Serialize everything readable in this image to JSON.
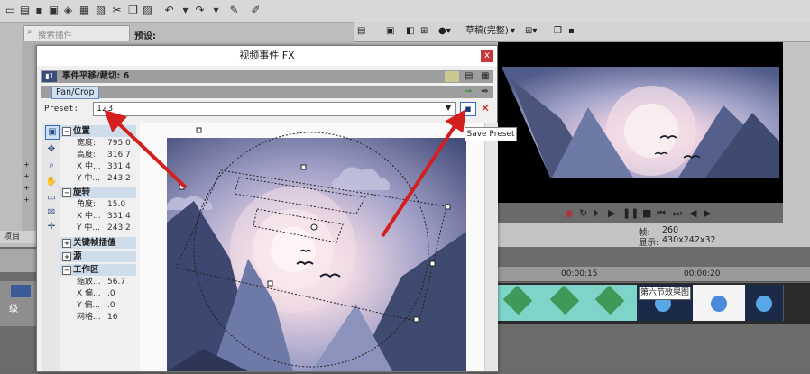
{
  "left_panel": {
    "search_placeholder": "搜索插件",
    "pane_label": "预设:",
    "tab_label": "项目"
  },
  "preview": {
    "quality_label": "草稿(完整)",
    "frame_label": "帧:",
    "frame_value": "260",
    "display_label": "显示:",
    "display_value": "430x242x32"
  },
  "timeline": {
    "time_15": "00:00:15",
    "time_20": "00:00:20",
    "track_label": "级"
  },
  "dialog": {
    "title": "视频事件 FX",
    "close": "x",
    "chain_label": "事件平移/裁切: 6",
    "fx_tab": "Pan/Crop",
    "preset_label": "Preset:",
    "preset_value": "123",
    "tooltip": "Save Preset",
    "sections": [
      {
        "name": "位置",
        "rows": [
          {
            "label": "宽度:",
            "value": "795.0"
          },
          {
            "label": "高度:",
            "value": "316.7"
          },
          {
            "label": "X 中...",
            "value": "331.4"
          },
          {
            "label": "Y 中...",
            "value": "243.2"
          }
        ]
      },
      {
        "name": "旋转",
        "rows": [
          {
            "label": "角度:",
            "value": "15.0"
          },
          {
            "label": "X 中...",
            "value": "331.4"
          },
          {
            "label": "Y 中...",
            "value": "243.2"
          }
        ]
      },
      {
        "name": "关键帧插值",
        "rows": []
      },
      {
        "name": "源",
        "rows": []
      },
      {
        "name": "工作区",
        "rows": [
          {
            "label": "缩放...",
            "value": "56.7"
          },
          {
            "label": "X 偏...",
            "value": ".0"
          },
          {
            "label": "Y 偏...",
            "value": ".0"
          },
          {
            "label": "网格...",
            "value": "16"
          }
        ]
      }
    ]
  },
  "clip_tooltip": "第六节效果图",
  "colors": {
    "arrow": "#d41f1f",
    "sky_top": "#3f4774",
    "sky_glow": "#f3dde7",
    "mountain": "#3e4a6f"
  }
}
